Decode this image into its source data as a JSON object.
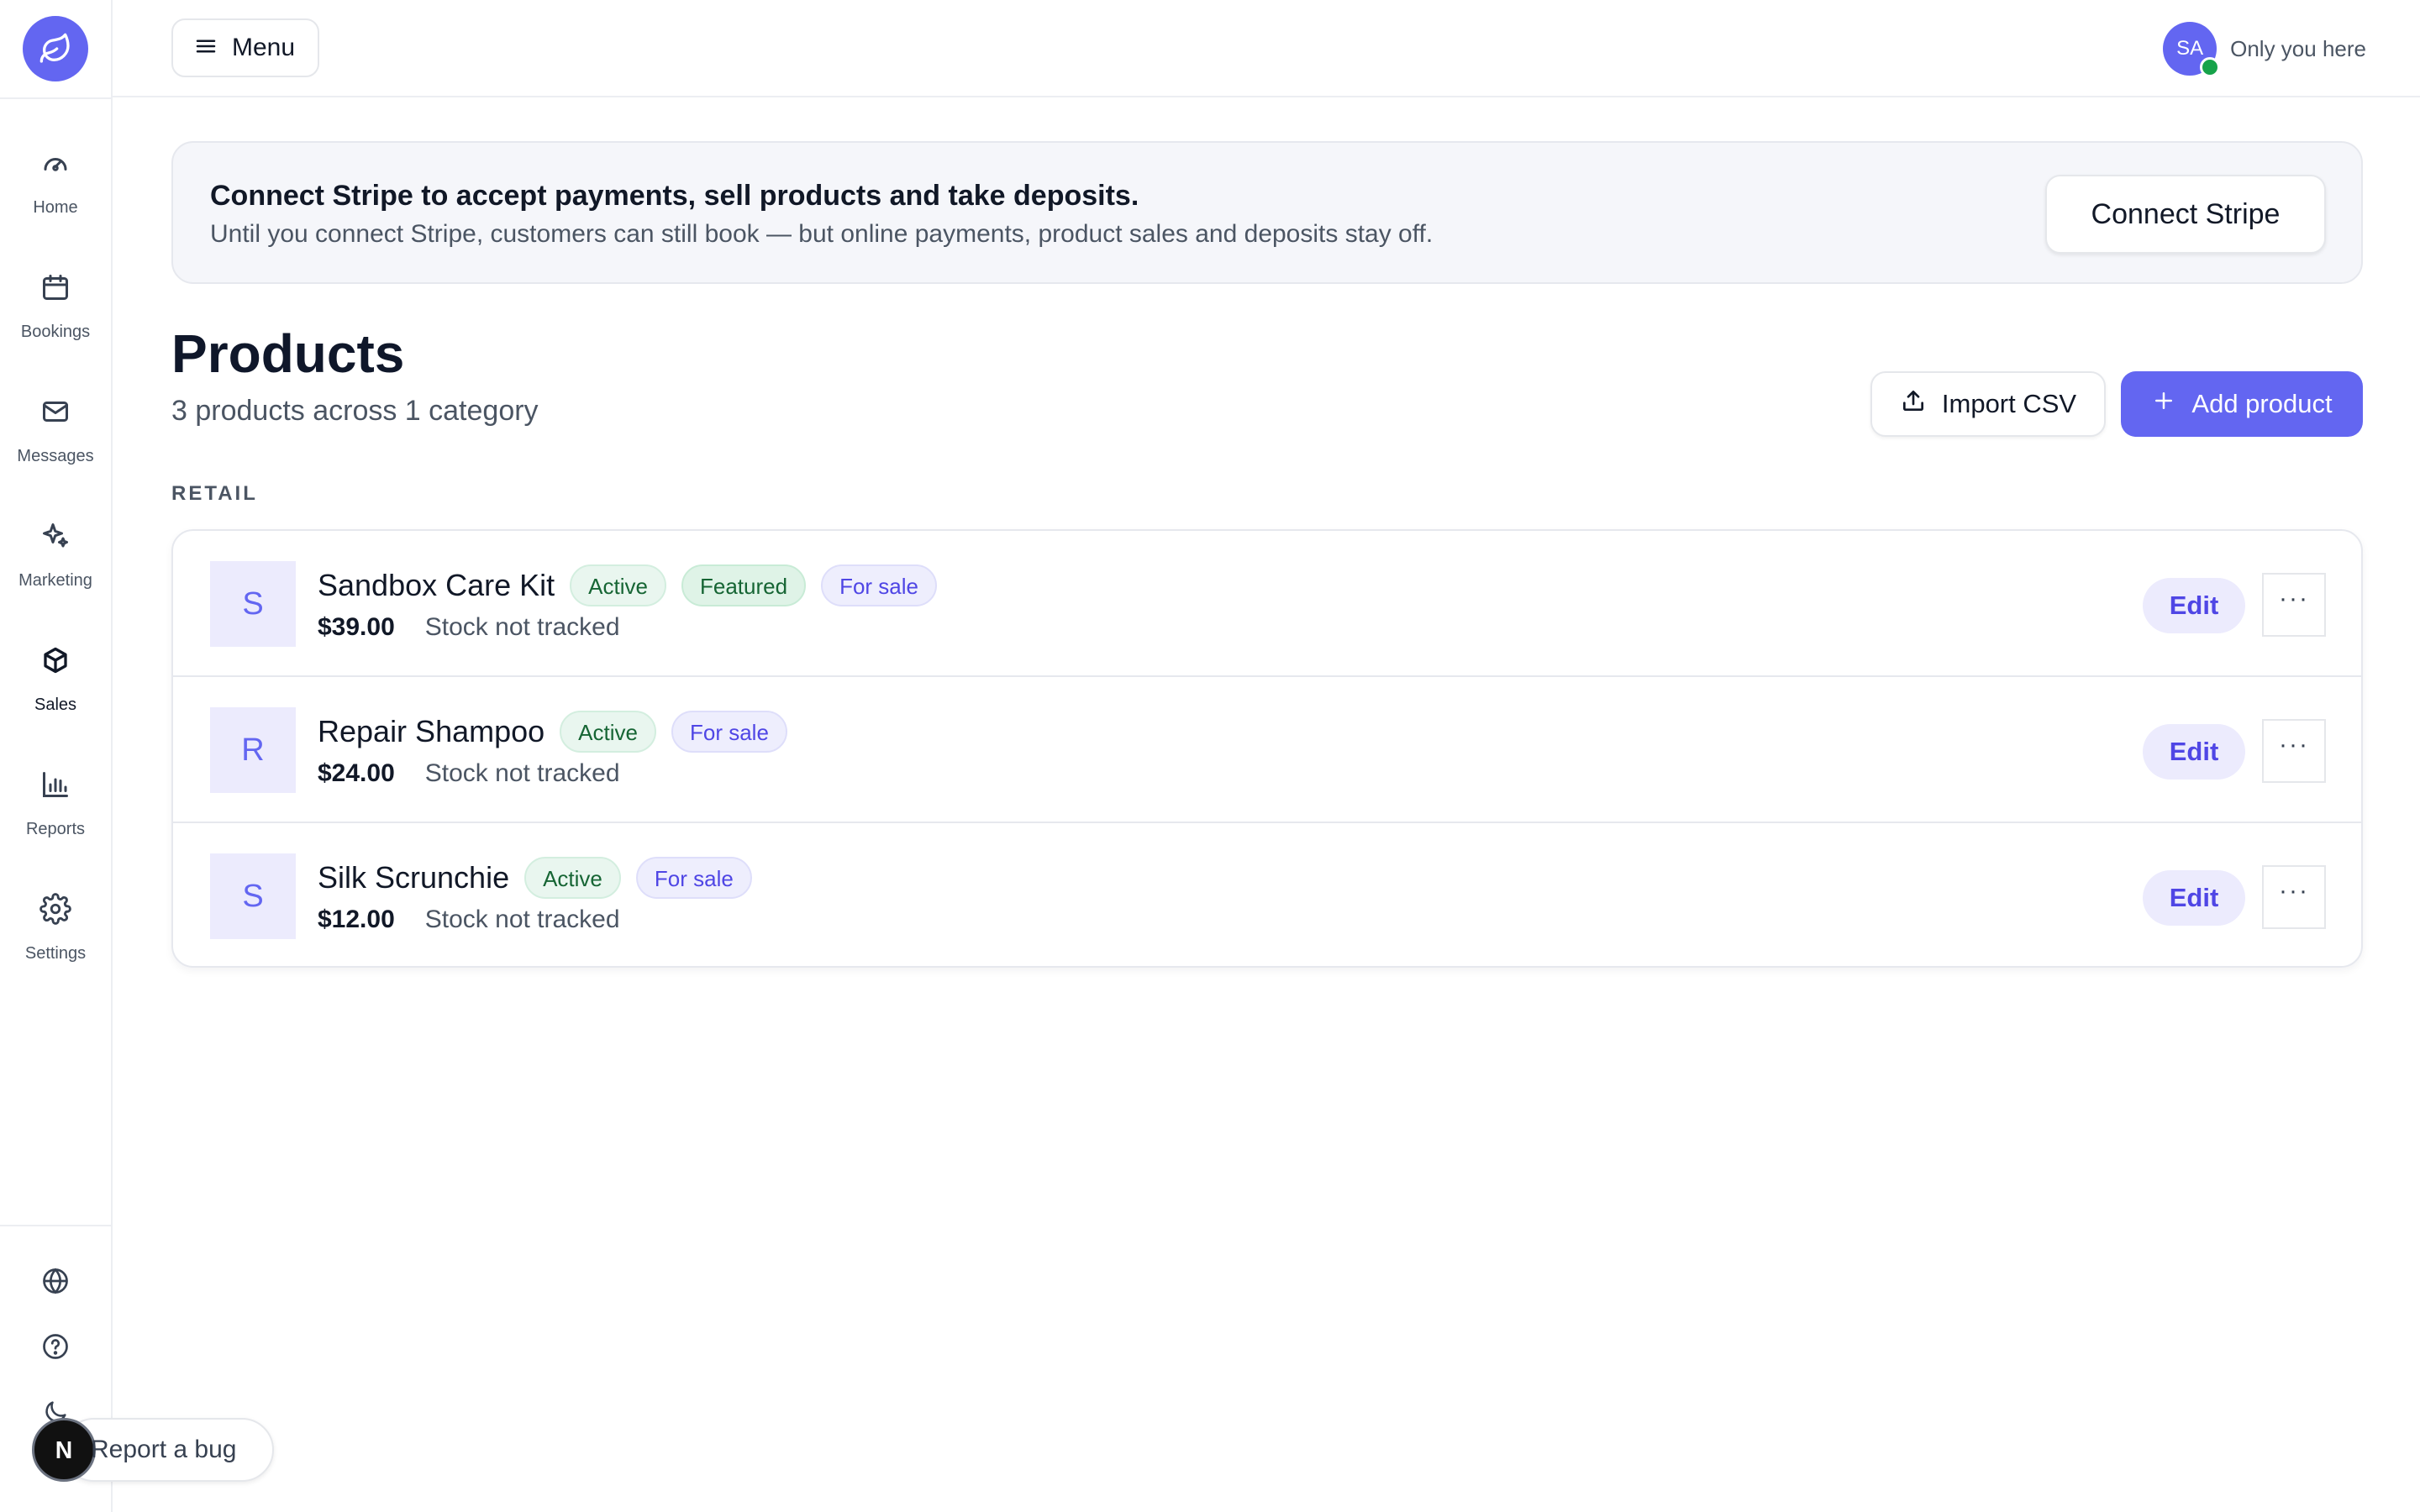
{
  "sidebar": {
    "items": [
      {
        "label": "Home",
        "icon": "gauge-icon"
      },
      {
        "label": "Bookings",
        "icon": "calendar-icon"
      },
      {
        "label": "Messages",
        "icon": "mail-icon"
      },
      {
        "label": "Marketing",
        "icon": "sparkles-icon"
      },
      {
        "label": "Sales",
        "icon": "box-icon",
        "active": true
      },
      {
        "label": "Reports",
        "icon": "bar-chart-icon"
      },
      {
        "label": "Settings",
        "icon": "gear-icon"
      }
    ],
    "bottom_icons": [
      "globe-icon",
      "help-icon",
      "moon-icon"
    ]
  },
  "topbar": {
    "menu_label": "Menu",
    "avatar_initials": "SA",
    "presence_text": "Only you here"
  },
  "banner": {
    "title": "Connect Stripe to accept payments, sell products and take deposits.",
    "description": "Until you connect Stripe, customers can still book — but online payments, product sales and deposits stay off.",
    "button_label": "Connect Stripe"
  },
  "header": {
    "title": "Products",
    "subtitle": "3 products across 1 category",
    "import_label": "Import CSV",
    "add_label": "Add product"
  },
  "section": {
    "label": "RETAIL"
  },
  "products": [
    {
      "initial": "S",
      "name": "Sandbox Care Kit",
      "badges": [
        "Active",
        "Featured",
        "For sale"
      ],
      "price": "$39.00",
      "stock": "Stock not tracked",
      "edit_label": "Edit",
      "more_label": "···"
    },
    {
      "initial": "R",
      "name": "Repair Shampoo",
      "badges": [
        "Active",
        "For sale"
      ],
      "price": "$24.00",
      "stock": "Stock not tracked",
      "edit_label": "Edit",
      "more_label": "···"
    },
    {
      "initial": "S",
      "name": "Silk Scrunchie",
      "badges": [
        "Active",
        "For sale"
      ],
      "price": "$12.00",
      "stock": "Stock not tracked",
      "edit_label": "Edit",
      "more_label": "···"
    }
  ],
  "bug_report": {
    "label": "Report a bug",
    "badge_letter": "N"
  },
  "colors": {
    "accent": "#6366f1",
    "online": "#16a34a",
    "badge_green_text": "#166534",
    "badge_purple_text": "#4f46e5"
  }
}
